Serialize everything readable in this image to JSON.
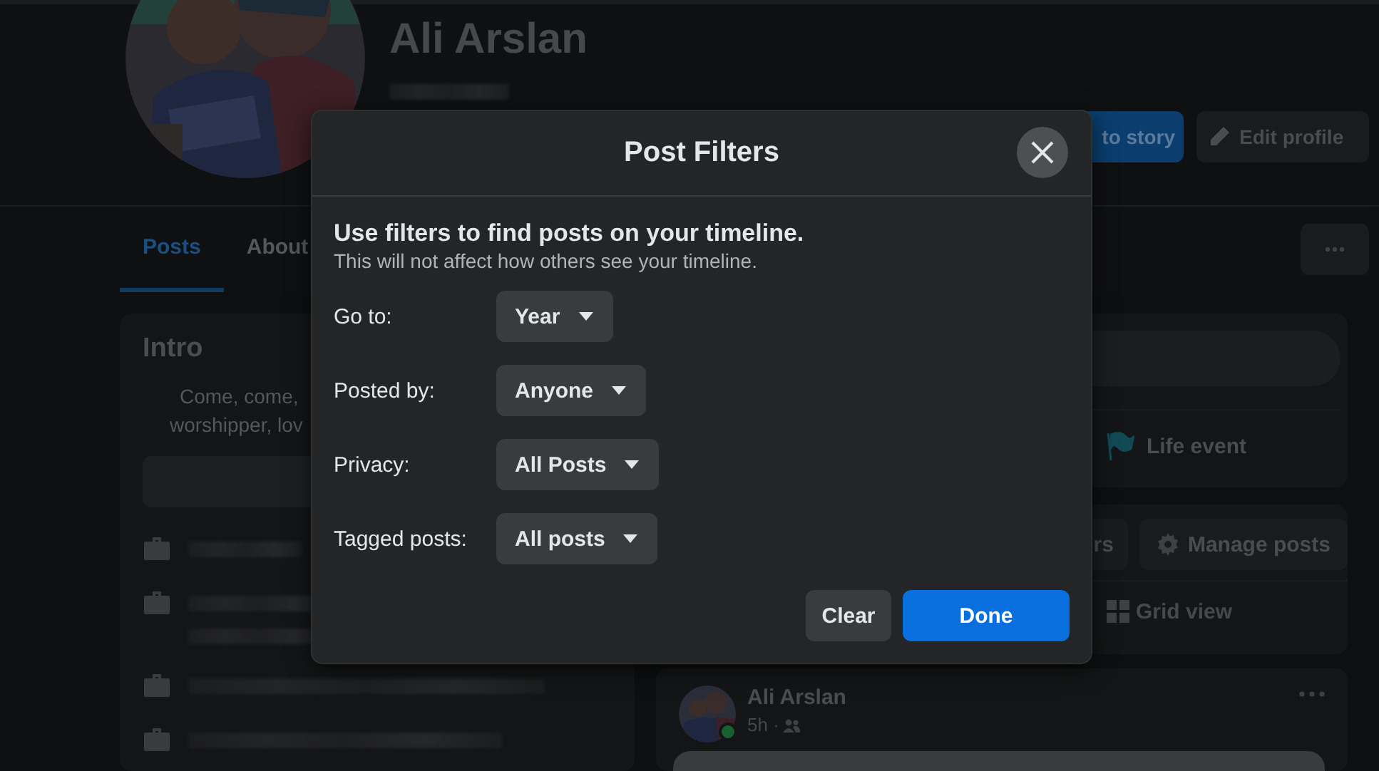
{
  "profile": {
    "name": "Ali Arslan",
    "buttons": [
      {
        "label": "to story",
        "kind": "primary"
      },
      {
        "label": "Edit profile",
        "kind": "secondary"
      }
    ],
    "tabs": [
      {
        "label": "Posts",
        "selected": true
      },
      {
        "label": "About",
        "selected": false
      }
    ],
    "intro": {
      "title": "Intro",
      "bio_lines": [
        "Come, come,",
        "worshipper, lov"
      ]
    },
    "composer": {
      "actions": [
        "Life event"
      ]
    },
    "posts_toolbar": {
      "buttons": [
        "rs",
        "Manage posts"
      ],
      "view": "Grid view"
    },
    "post": {
      "author": "Ali Arslan",
      "time": "5h ·",
      "online": true
    }
  },
  "dialog": {
    "title": "Post Filters",
    "heading": "Use filters to find posts on your timeline.",
    "subheading": "This will not affect how others see your timeline.",
    "filters": [
      {
        "label": "Go to:",
        "value": "Year"
      },
      {
        "label": "Posted by:",
        "value": "Anyone"
      },
      {
        "label": "Privacy:",
        "value": "All Posts"
      },
      {
        "label": "Tagged posts:",
        "value": "All posts"
      }
    ],
    "buttons": [
      {
        "label": "Clear",
        "kind": "secondary"
      },
      {
        "label": "Done",
        "kind": "primary"
      }
    ]
  }
}
